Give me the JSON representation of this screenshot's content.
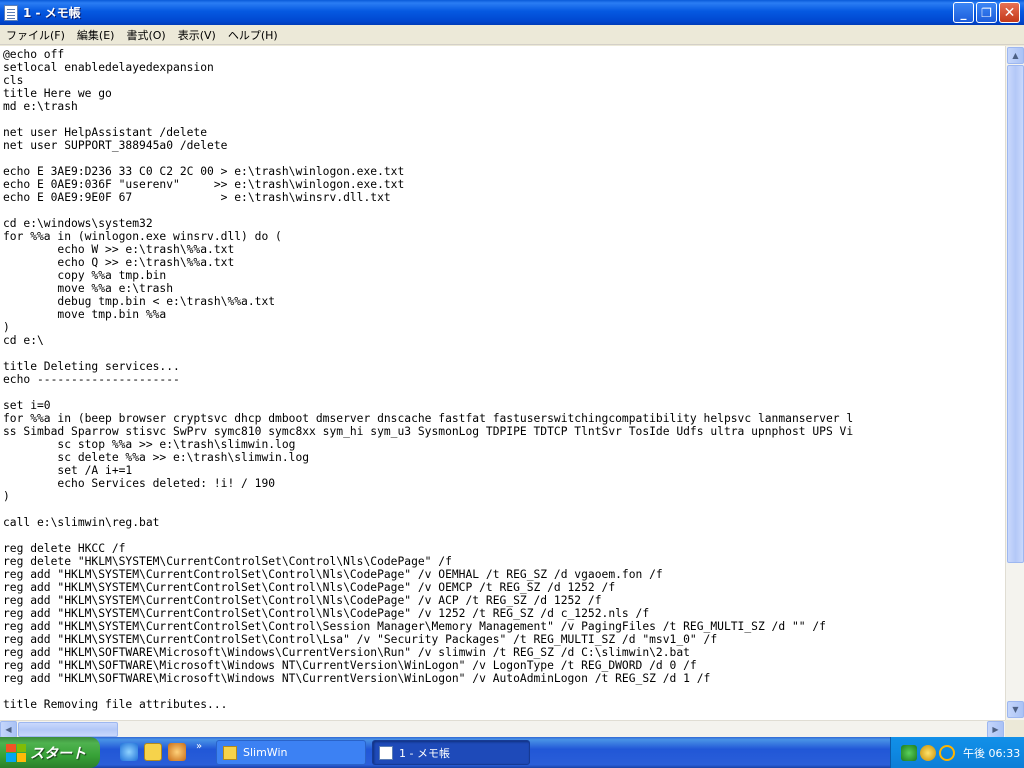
{
  "window": {
    "title": "1 - メモ帳",
    "minimize_symbol": "_",
    "maximize_symbol": "❐",
    "close_symbol": "✕"
  },
  "menu": {
    "items": [
      "ファイル(F)",
      "編集(E)",
      "書式(O)",
      "表示(V)",
      "ヘルプ(H)"
    ]
  },
  "editor": {
    "lines": [
      "@echo off",
      "setlocal enabledelayedexpansion",
      "cls",
      "title Here we go",
      "md e:\\trash",
      "",
      "net user HelpAssistant /delete",
      "net user SUPPORT_388945a0 /delete",
      "",
      "echo E 3AE9:D236 33 C0 C2 2C 00 > e:\\trash\\winlogon.exe.txt",
      "echo E 0AE9:036F \"userenv\"     >> e:\\trash\\winlogon.exe.txt",
      "echo E 0AE9:9E0F 67             > e:\\trash\\winsrv.dll.txt",
      "",
      "cd e:\\windows\\system32",
      "for %%a in (winlogon.exe winsrv.dll) do (",
      "        echo W >> e:\\trash\\%%a.txt",
      "        echo Q >> e:\\trash\\%%a.txt",
      "        copy %%a tmp.bin",
      "        move %%a e:\\trash",
      "        debug tmp.bin < e:\\trash\\%%a.txt",
      "        move tmp.bin %%a",
      ")",
      "cd e:\\",
      "",
      "title Deleting services...",
      "echo ---------------------",
      "",
      "set i=0",
      "for %%a in (beep browser cryptsvc dhcp dmboot dmserver dnscache fastfat fastuserswitchingcompatibility helpsvc lanmanserver l",
      "ss Simbad Sparrow stisvc SwPrv symc810 symc8xx sym_hi sym_u3 SysmonLog TDPIPE TDTCP TlntSvr TosIde Udfs ultra upnphost UPS Vi",
      "        sc stop %%a >> e:\\trash\\slimwin.log",
      "        sc delete %%a >> e:\\trash\\slimwin.log",
      "        set /A i+=1",
      "        echo Services deleted: !i! / 190",
      ")",
      "",
      "call e:\\slimwin\\reg.bat",
      "",
      "reg delete HKCC /f",
      "reg delete \"HKLM\\SYSTEM\\CurrentControlSet\\Control\\Nls\\CodePage\" /f",
      "reg add \"HKLM\\SYSTEM\\CurrentControlSet\\Control\\Nls\\CodePage\" /v OEMHAL /t REG_SZ /d vgaoem.fon /f",
      "reg add \"HKLM\\SYSTEM\\CurrentControlSet\\Control\\Nls\\CodePage\" /v OEMCP /t REG_SZ /d 1252 /f",
      "reg add \"HKLM\\SYSTEM\\CurrentControlSet\\Control\\Nls\\CodePage\" /v ACP /t REG_SZ /d 1252 /f",
      "reg add \"HKLM\\SYSTEM\\CurrentControlSet\\Control\\Nls\\CodePage\" /v 1252 /t REG_SZ /d c_1252.nls /f",
      "reg add \"HKLM\\SYSTEM\\CurrentControlSet\\Control\\Session Manager\\Memory Management\" /v PagingFiles /t REG_MULTI_SZ /d \"\" /f",
      "reg add \"HKLM\\SYSTEM\\CurrentControlSet\\Control\\Lsa\" /v \"Security Packages\" /t REG_MULTI_SZ /d \"msv1_0\" /f",
      "reg add \"HKLM\\SOFTWARE\\Microsoft\\Windows\\CurrentVersion\\Run\" /v slimwin /t REG_SZ /d C:\\slimwin\\2.bat",
      "reg add \"HKLM\\SOFTWARE\\Microsoft\\Windows NT\\CurrentVersion\\WinLogon\" /v LogonType /t REG_DWORD /d 0 /f",
      "reg add \"HKLM\\SOFTWARE\\Microsoft\\Windows NT\\CurrentVersion\\WinLogon\" /v AutoAdminLogon /t REG_SZ /d 1 /f",
      "",
      "title Removing file attributes..."
    ]
  },
  "scrollbars": {
    "up_arrow": "▲",
    "down_arrow": "▼",
    "left_arrow": "◀",
    "right_arrow": "▶"
  },
  "taskbar": {
    "start_label": "スタート",
    "quick_launch_more": "»",
    "tasks": [
      {
        "label": "SlimWin",
        "icon": "folder-icon"
      },
      {
        "label": "1 - メモ帳",
        "icon": "notepad-icon"
      }
    ],
    "clock": "午後 06:33"
  },
  "colors": {
    "titlebar": "#0559e1",
    "taskbar": "#2157d7",
    "start_button": "#37a237",
    "tray": "#0f8ae3",
    "editor_bg": "#ffffff"
  }
}
